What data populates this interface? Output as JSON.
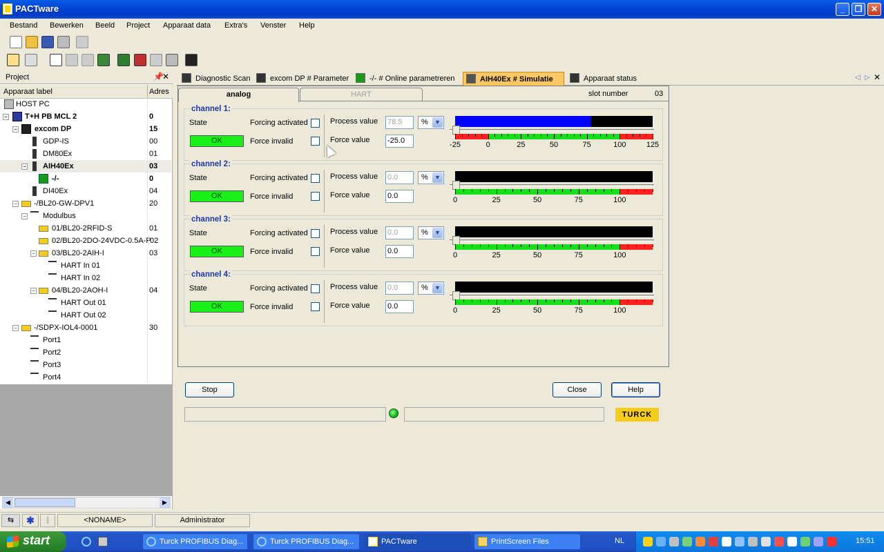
{
  "window": {
    "title": "PACTware",
    "min_icon": "minimize-icon",
    "max_icon": "restore-icon",
    "close_icon": "close-icon"
  },
  "menu": [
    "Bestand",
    "Bewerken",
    "Beeld",
    "Project",
    "Apparaat data",
    "Extra's",
    "Venster",
    "Help"
  ],
  "project_panel": {
    "title": "Project",
    "col_label": "Apparaat label",
    "col_address": "Adres",
    "tree": [
      {
        "label": "HOST PC",
        "addr": ""
      },
      {
        "label": "T+H PB MCL 2",
        "addr": "0"
      },
      {
        "label": "excom DP",
        "addr": "15"
      },
      {
        "label": "GDP-IS",
        "addr": "00"
      },
      {
        "label": "DM80Ex",
        "addr": "01"
      },
      {
        "label": "AIH40Ex",
        "addr": "03"
      },
      {
        "label": "-/-",
        "addr": "0"
      },
      {
        "label": "DI40Ex",
        "addr": "04"
      },
      {
        "label": "-/BL20-GW-DPV1",
        "addr": "20"
      },
      {
        "label": "Modulbus",
        "addr": ""
      },
      {
        "label": "01/BL20-2RFID-S",
        "addr": "01"
      },
      {
        "label": "02/BL20-2DO-24VDC-0.5A-P",
        "addr": "02"
      },
      {
        "label": "03/BL20-2AIH-I",
        "addr": "03"
      },
      {
        "label": "HART In 01",
        "addr": ""
      },
      {
        "label": "HART In 02",
        "addr": ""
      },
      {
        "label": "04/BL20-2AOH-I",
        "addr": "04"
      },
      {
        "label": "HART Out 01",
        "addr": ""
      },
      {
        "label": "HART Out 02",
        "addr": ""
      },
      {
        "label": "-/SDPX-IOL4-0001",
        "addr": "30"
      },
      {
        "label": "Port1",
        "addr": ""
      },
      {
        "label": "Port2",
        "addr": ""
      },
      {
        "label": "Port3",
        "addr": ""
      },
      {
        "label": "Port4",
        "addr": ""
      }
    ]
  },
  "doc_tabs": [
    {
      "label": "Diagnostic Scan"
    },
    {
      "label": "excom DP # Parameter"
    },
    {
      "label": "-/- # Online parametreren"
    },
    {
      "label": "AIH40Ex # Simulatie"
    },
    {
      "label": "Apparaat status"
    }
  ],
  "simulation": {
    "subtab_analog": "analog",
    "subtab_hart": "HART",
    "slot_label": "slot number",
    "slot_value": "03",
    "labels": {
      "state": "State",
      "forcing": "Forcing activated",
      "force_invalid": "Force invalid",
      "process_value": "Process value",
      "force_value": "Force value"
    },
    "channels": [
      {
        "title": "channel 1:",
        "state": "OK",
        "process_value": "78.5",
        "unit": "%",
        "force_value": "-25.0",
        "level_pct": 0.69,
        "ticks": [
          "-25",
          "0",
          "25",
          "50",
          "75",
          "100",
          "125"
        ]
      },
      {
        "title": "channel 2:",
        "state": "OK",
        "process_value": "0.0",
        "unit": "%",
        "force_value": "0.0",
        "level_pct": 0,
        "ticks": [
          "0",
          "25",
          "50",
          "75",
          "100"
        ]
      },
      {
        "title": "channel 3:",
        "state": "OK",
        "process_value": "0.0",
        "unit": "%",
        "force_value": "0.0",
        "level_pct": 0,
        "ticks": [
          "0",
          "25",
          "50",
          "75",
          "100"
        ]
      },
      {
        "title": "channel 4:",
        "state": "OK",
        "process_value": "0.0",
        "unit": "%",
        "force_value": "0.0",
        "level_pct": 0,
        "ticks": [
          "0",
          "25",
          "50",
          "75",
          "100"
        ]
      }
    ],
    "buttons": {
      "stop": "Stop",
      "close": "Close",
      "help": "Help"
    },
    "brand": "TURCK"
  },
  "statusbar": {
    "project": "<NONAME>",
    "user": "Administrator"
  },
  "taskbar": {
    "start": "start",
    "tasks": [
      "Turck PROFIBUS Diag...",
      "Turck PROFIBUS Diag...",
      "PACTware",
      "PrintScreen Files"
    ],
    "lang": "NL",
    "clock": "15:51"
  },
  "colors": {
    "ok_green": "#18f018",
    "bar_blue": "#0000ff",
    "tab_active": "#fcc864",
    "channel_title": "#1a3aa8"
  }
}
